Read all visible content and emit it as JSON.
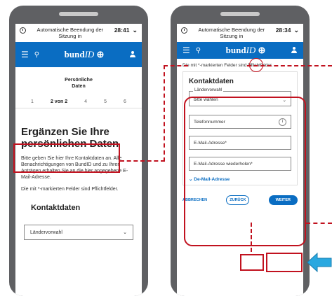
{
  "screen1": {
    "timer_text": "Automatische Beendung der Sitzung in",
    "timer_value": "28:41",
    "logo_bund": "bund",
    "logo_id": "ID",
    "stepper_title": "Persönliche Daten",
    "stepper_current": "2 von 2",
    "steps": [
      "1",
      "4",
      "5",
      "6"
    ],
    "heading": "Ergänzen Sie Ihre persönlichen Daten",
    "intro": "Bitte geben Sie hier Ihre Kontaktdaten an. Alle Benachrichtigungen von BundID und zu Ihren Anträgen erhalten Sie an die hier angegebene E-Mail-Adresse.",
    "required_hint": "Die mit *-markierten Felder sind Pflichtfelder.",
    "section_title": "Kontaktdaten",
    "country_select": "Ländervorwahl"
  },
  "screen2": {
    "timer_text": "Automatische Beendung der Sitzung in",
    "timer_value": "28:34",
    "logo_bund": "bund",
    "logo_id": "ID",
    "required_hint": "Die mit *-markierten Felder sind Pflichtfelder.",
    "section_title": "Kontaktdaten",
    "country_label": "Ländervorwahl",
    "country_value": "bitte wählen",
    "phone_placeholder": "Telefonnummer",
    "email_placeholder": "E-Mail-Adresse*",
    "email_repeat_placeholder": "E-Mail-Adresse wiederholen*",
    "de_mail_link": "De-Mail-Adresse",
    "cancel_label": "ABBRECHEN",
    "back_label": "ZURÜCK",
    "next_label": "WEITER"
  },
  "colors": {
    "accent": "#0a6dc2",
    "annotation": "#c1121f",
    "arrow": "#2aa8e0"
  }
}
